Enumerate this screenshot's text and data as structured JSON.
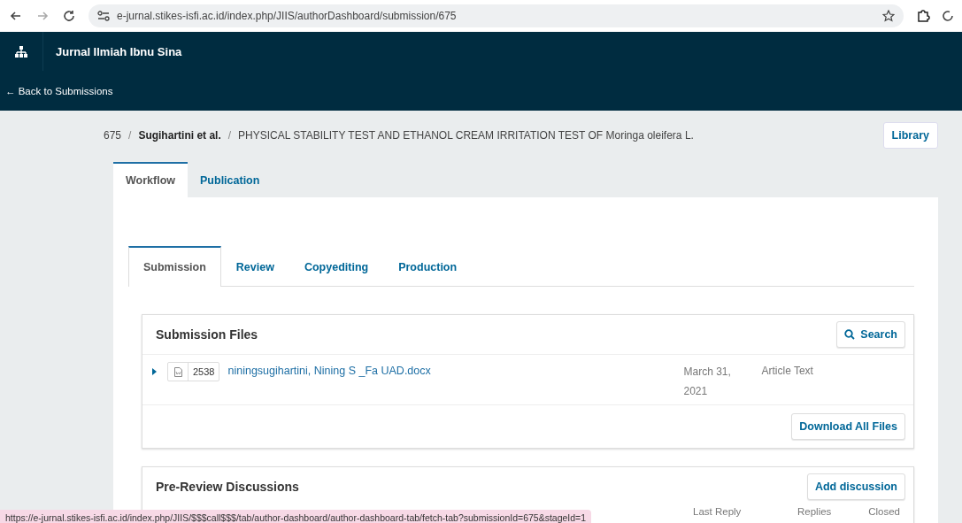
{
  "browser": {
    "url": "e-jurnal.stikes-isfi.ac.id/index.php/JIIS/authorDashboard/submission/675"
  },
  "header": {
    "site_title": "Jurnal Ilmiah Ibnu Sina",
    "back_link": "← Back to Submissions"
  },
  "breadcrumb": {
    "id": "675",
    "separators": [
      "/",
      "/"
    ],
    "author": "Sugihartini et al.",
    "title": "PHYSICAL STABILITY TEST AND ETHANOL CREAM IRRITATION TEST OF Moringa oleifera L.",
    "library_button": "Library"
  },
  "workflow_tabs": [
    {
      "label": "Workflow",
      "selected": true
    },
    {
      "label": "Publication",
      "selected": false
    }
  ],
  "stage_tabs": [
    {
      "label": "Submission",
      "selected": true
    },
    {
      "label": "Review",
      "selected": false
    },
    {
      "label": "Copyediting",
      "selected": false
    },
    {
      "label": "Production",
      "selected": false
    }
  ],
  "submission_files": {
    "title": "Submission Files",
    "search_button": "Search",
    "files": [
      {
        "id": "2538",
        "name": "niningsugihartini, Nining S _Fa UAD.docx",
        "date": "March 31, 2021",
        "type": "Article Text",
        "expanded": false
      }
    ],
    "download_button": "Download All Files"
  },
  "pre_review": {
    "title": "Pre-Review Discussions",
    "add_button": "Add discussion",
    "columns": [
      "Last Reply",
      "Replies",
      "Closed"
    ]
  },
  "status_url": "https://e-jurnal.stikes-isfi.ac.id/index.php/JIIS/$$$call$$$/tab/author-dashboard/author-dashboard-tab/fetch-tab?submissionId=675&stageId=1"
}
